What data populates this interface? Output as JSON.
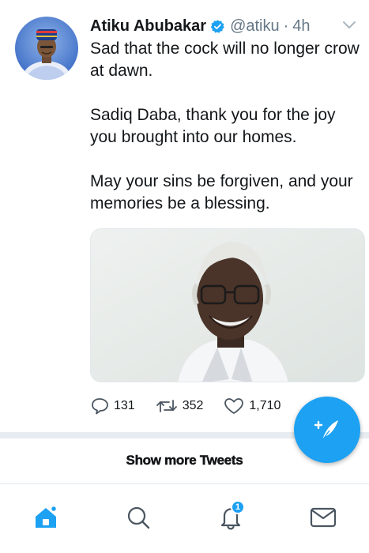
{
  "tweet": {
    "author_name": "Atiku Abubakar",
    "handle": "@atiku",
    "separator": "·",
    "time": "4h",
    "paragraphs": [
      "Sad that the cock will no longer crow at dawn.",
      "Sadiq Daba, thank you for the joy you brought into our homes.",
      "May your sins be forgiven, and your memories be a blessing."
    ],
    "replies": "131",
    "retweets": "352",
    "likes": "1,710"
  },
  "timeline": {
    "show_more_label": "Show more Tweets"
  },
  "tabbar": {
    "notifications_badge": "1"
  },
  "colors": {
    "accent": "#1da1f2",
    "text": "#14171a",
    "secondary_text": "#657786",
    "divider": "#e6ecf0"
  },
  "icons": {
    "verified": "verified-badge-icon",
    "more": "chevron-down-icon",
    "reply": "reply-icon",
    "retweet": "retweet-icon",
    "like": "heart-icon",
    "compose": "compose-feather-icon",
    "home": "home-icon",
    "search": "search-icon",
    "notifications": "bell-icon",
    "messages": "envelope-icon"
  }
}
